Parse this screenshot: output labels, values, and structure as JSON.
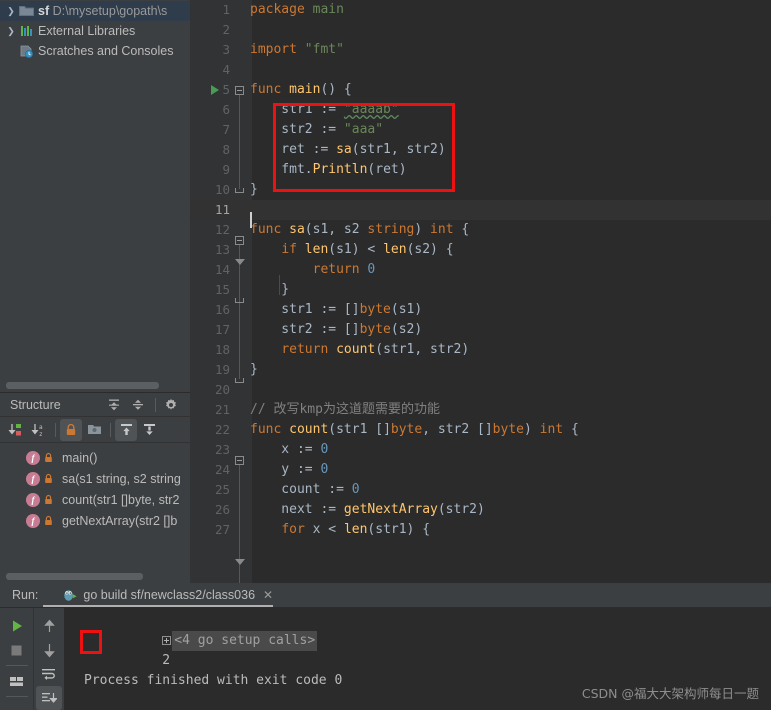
{
  "project_tree": {
    "items": [
      {
        "arrow": "▶",
        "icon": "folder-icon",
        "name_bold": "sf",
        "name_dim": "D:\\mysetup\\gopath\\s",
        "selected": true
      },
      {
        "arrow": "▶",
        "icon": "libraries-icon",
        "name_bold": "",
        "name_dim": "External Libraries",
        "selected": false
      },
      {
        "arrow": "",
        "icon": "scratches-icon",
        "name_bold": "",
        "name_dim": "Scratches and Consoles",
        "selected": false
      }
    ]
  },
  "structure": {
    "title": "Structure",
    "header_icons": [
      "expand-all-icon",
      "collapse-all-icon",
      "gear-icon"
    ],
    "toolbar_icons": [
      {
        "name": "sort-by-visibility-icon",
        "active": false
      },
      {
        "name": "sort-alphabetically-icon",
        "active": false
      },
      {
        "name": "show-non-public-icon",
        "active": true
      },
      {
        "name": "group-icon",
        "active": false
      },
      {
        "name": "show-inherited-icon",
        "active": true
      },
      {
        "name": "show-fields-icon",
        "active": false
      }
    ],
    "items": [
      {
        "badge": "f",
        "label": "main()"
      },
      {
        "badge": "f",
        "label": "sa(s1 string, s2 string"
      },
      {
        "badge": "f",
        "label": "count(str1 []byte, str2"
      },
      {
        "badge": "f",
        "label": "getNextArray(str2 []b"
      }
    ]
  },
  "editor": {
    "lines": [
      {
        "n": "1",
        "tokens": [
          {
            "t": "package ",
            "c": "kw"
          },
          {
            "t": "main",
            "c": "pkg"
          }
        ],
        "indent": 0
      },
      {
        "n": "2",
        "tokens": [],
        "indent": 0
      },
      {
        "n": "3",
        "tokens": [
          {
            "t": "import ",
            "c": "kw"
          },
          {
            "t": "\"fmt\"",
            "c": "str"
          }
        ],
        "indent": 0
      },
      {
        "n": "4",
        "tokens": [],
        "indent": 0
      },
      {
        "n": "5",
        "tokens": [
          {
            "t": "func ",
            "c": "kw"
          },
          {
            "t": "main",
            "c": "fn"
          },
          {
            "t": "() {",
            "c": "pln"
          }
        ],
        "indent": 0
      },
      {
        "n": "6",
        "tokens": [
          {
            "t": "    str1 := ",
            "c": "pln"
          },
          {
            "t": "\"aaaab\"",
            "c": "str squig"
          }
        ],
        "indent": 1
      },
      {
        "n": "7",
        "tokens": [
          {
            "t": "    str2 := ",
            "c": "pln"
          },
          {
            "t": "\"aaa\"",
            "c": "str"
          }
        ],
        "indent": 1
      },
      {
        "n": "8",
        "tokens": [
          {
            "t": "    ret := ",
            "c": "pln"
          },
          {
            "t": "sa",
            "c": "fn"
          },
          {
            "t": "(str1, str2)",
            "c": "pln"
          }
        ],
        "indent": 1
      },
      {
        "n": "9",
        "tokens": [
          {
            "t": "    fmt.",
            "c": "pln"
          },
          {
            "t": "Println",
            "c": "fn"
          },
          {
            "t": "(ret)",
            "c": "pln"
          }
        ],
        "indent": 1
      },
      {
        "n": "10",
        "tokens": [
          {
            "t": "}",
            "c": "pln"
          }
        ],
        "indent": 0
      },
      {
        "n": "11",
        "tokens": [],
        "indent": 0,
        "current": true
      },
      {
        "n": "12",
        "tokens": [
          {
            "t": "func ",
            "c": "kw"
          },
          {
            "t": "sa",
            "c": "fn"
          },
          {
            "t": "(s1, s2 ",
            "c": "pln"
          },
          {
            "t": "string",
            "c": "kw"
          },
          {
            "t": ") ",
            "c": "pln"
          },
          {
            "t": "int",
            "c": "kw"
          },
          {
            "t": " {",
            "c": "pln"
          }
        ],
        "indent": 0
      },
      {
        "n": "13",
        "tokens": [
          {
            "t": "    ",
            "c": "pln"
          },
          {
            "t": "if",
            "c": "kw"
          },
          {
            "t": " ",
            "c": "pln"
          },
          {
            "t": "len",
            "c": "fn"
          },
          {
            "t": "(s1) < ",
            "c": "pln"
          },
          {
            "t": "len",
            "c": "fn"
          },
          {
            "t": "(s2) {",
            "c": "pln"
          }
        ],
        "indent": 1
      },
      {
        "n": "14",
        "tokens": [
          {
            "t": "        ",
            "c": "pln"
          },
          {
            "t": "return",
            "c": "kw"
          },
          {
            "t": " ",
            "c": "pln"
          },
          {
            "t": "0",
            "c": "num"
          }
        ],
        "indent": 2
      },
      {
        "n": "15",
        "tokens": [
          {
            "t": "    }",
            "c": "pln"
          }
        ],
        "indent": 1
      },
      {
        "n": "16",
        "tokens": [
          {
            "t": "    str1 := []",
            "c": "pln"
          },
          {
            "t": "byte",
            "c": "kw"
          },
          {
            "t": "(s1)",
            "c": "pln"
          }
        ],
        "indent": 1
      },
      {
        "n": "17",
        "tokens": [
          {
            "t": "    str2 := []",
            "c": "pln"
          },
          {
            "t": "byte",
            "c": "kw"
          },
          {
            "t": "(s2)",
            "c": "pln"
          }
        ],
        "indent": 1
      },
      {
        "n": "18",
        "tokens": [
          {
            "t": "    ",
            "c": "pln"
          },
          {
            "t": "return",
            "c": "kw"
          },
          {
            "t": " ",
            "c": "pln"
          },
          {
            "t": "count",
            "c": "fn"
          },
          {
            "t": "(str1, str2)",
            "c": "pln"
          }
        ],
        "indent": 1
      },
      {
        "n": "19",
        "tokens": [
          {
            "t": "}",
            "c": "pln"
          }
        ],
        "indent": 0
      },
      {
        "n": "20",
        "tokens": [],
        "indent": 0
      },
      {
        "n": "21",
        "tokens": [
          {
            "t": "// 改写kmp为这道题需要的功能",
            "c": "cmt"
          }
        ],
        "indent": 0
      },
      {
        "n": "22",
        "tokens": [
          {
            "t": "func ",
            "c": "kw"
          },
          {
            "t": "count",
            "c": "fn"
          },
          {
            "t": "(str1 []",
            "c": "pln"
          },
          {
            "t": "byte",
            "c": "kw"
          },
          {
            "t": ", str2 []",
            "c": "pln"
          },
          {
            "t": "byte",
            "c": "kw"
          },
          {
            "t": ") ",
            "c": "pln"
          },
          {
            "t": "int",
            "c": "kw"
          },
          {
            "t": " {",
            "c": "pln"
          }
        ],
        "indent": 0
      },
      {
        "n": "23",
        "tokens": [
          {
            "t": "    x := ",
            "c": "pln"
          },
          {
            "t": "0",
            "c": "num"
          }
        ],
        "indent": 1
      },
      {
        "n": "24",
        "tokens": [
          {
            "t": "    y := ",
            "c": "pln"
          },
          {
            "t": "0",
            "c": "num"
          }
        ],
        "indent": 1
      },
      {
        "n": "25",
        "tokens": [
          {
            "t": "    count := ",
            "c": "pln"
          },
          {
            "t": "0",
            "c": "num"
          }
        ],
        "indent": 1
      },
      {
        "n": "26",
        "tokens": [
          {
            "t": "    next := ",
            "c": "pln"
          },
          {
            "t": "getNextArray",
            "c": "fn"
          },
          {
            "t": "(str2)",
            "c": "pln"
          }
        ],
        "indent": 1
      },
      {
        "n": "27",
        "tokens": [
          {
            "t": "    ",
            "c": "pln"
          },
          {
            "t": "for",
            "c": "kw"
          },
          {
            "t": " x < ",
            "c": "pln"
          },
          {
            "t": "len",
            "c": "fn"
          },
          {
            "t": "(str1) {",
            "c": "pln"
          }
        ],
        "indent": 1
      }
    ]
  },
  "annotations": {
    "code_highlight_color": "#ee1111",
    "output_highlight_color": "#ee1111"
  },
  "run_panel": {
    "label": "Run:",
    "tab_title": "go build sf/newclass2/class036",
    "tab_icon": "go-gopher-icon",
    "close_icon": "close-icon",
    "toolbar_left": [
      {
        "name": "run-button-icon",
        "active": false
      },
      {
        "name": "stop-button-icon",
        "active": false
      },
      {
        "name": "layout-toggle-icon",
        "active": false
      }
    ],
    "toolbar_right": [
      {
        "name": "up-arrow-icon",
        "active": false
      },
      {
        "name": "down-arrow-icon",
        "active": false
      },
      {
        "name": "soft-wrap-icon",
        "active": false
      },
      {
        "name": "scroll-to-end-icon",
        "active": true
      }
    ],
    "console": {
      "setup_calls": "<4 go setup calls>",
      "output_value": "2",
      "exit_message": "Process finished with exit code 0"
    }
  },
  "watermark": "CSDN @福大大架构师每日一题"
}
